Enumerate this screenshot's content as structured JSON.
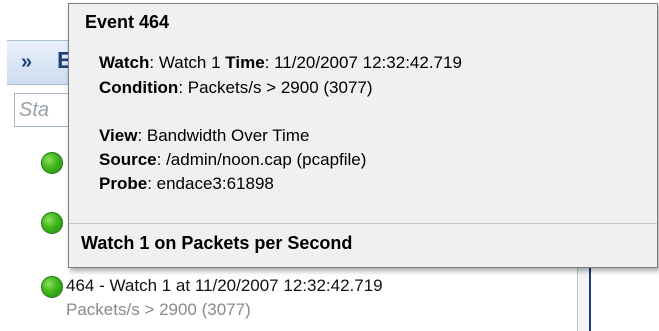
{
  "panel": {
    "expand_glyph": "»",
    "header_label_partial": "E",
    "search": {
      "placeholder": "Sta"
    },
    "items": [
      {
        "status": "green-dot",
        "title": "464 - Watch 1 at 11/20/2007 12:32:42.719",
        "subtitle": "Packets/s > 2900 (3077)"
      }
    ]
  },
  "tooltip": {
    "title": "Event 464",
    "watch_label": "Watch",
    "watch_value": ": Watch 1 ",
    "time_label": "Time",
    "time_value": ": 11/20/2007 12:32:42.719",
    "condition_label": "Condition",
    "condition_value": ": Packets/s > 2900 (3077)",
    "view_label": "View",
    "view_value": ": Bandwidth Over Time",
    "source_label": "Source",
    "source_value": ": /admin/noon.cap (pcapfile)",
    "probe_label": "Probe",
    "probe_value": ": endace3:61898",
    "footer": "Watch 1 on Packets per Second"
  },
  "colors": {
    "status_green": "#40b51c",
    "header_blue": "#1f3f78",
    "tooltip_bg": "#f0f0f0"
  }
}
